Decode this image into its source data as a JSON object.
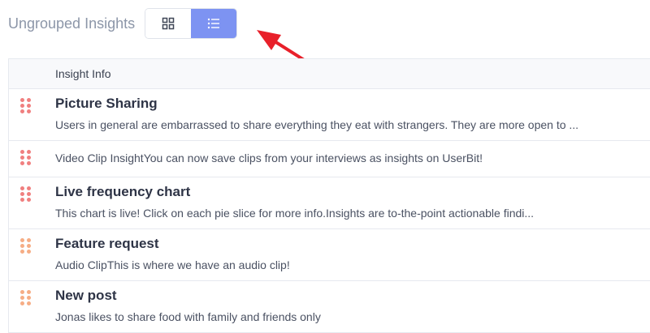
{
  "header": {
    "title": "Ungrouped Insights",
    "view_toggle": {
      "grid_icon": "grid-icon",
      "list_icon": "list-icon",
      "selected": "list"
    }
  },
  "table": {
    "column_header": "Insight Info",
    "rows": [
      {
        "title": "Picture Sharing",
        "description": "Users in general are embarrassed to share everything they eat with strangers. They are more open to ...",
        "handle_color": "#f07f7f"
      },
      {
        "title": "",
        "description": "Video Clip InsightYou can now save clips from your interviews as insights on UserBit!",
        "handle_color": "#f07f7f"
      },
      {
        "title": "Live frequency chart",
        "description": "This chart is live! Click on each pie slice for more info.Insights are to-the-point actionable findi...",
        "handle_color": "#f07f7f"
      },
      {
        "title": "Feature request",
        "description": "Audio ClipThis is where we have an audio clip!",
        "handle_color": "#f6ad85"
      },
      {
        "title": "New post",
        "description": "Jonas likes to share food with family and friends only",
        "handle_color": "#f6ad85"
      }
    ]
  },
  "colors": {
    "accent": "#7d93f2",
    "annotation_arrow": "#e8202a"
  }
}
